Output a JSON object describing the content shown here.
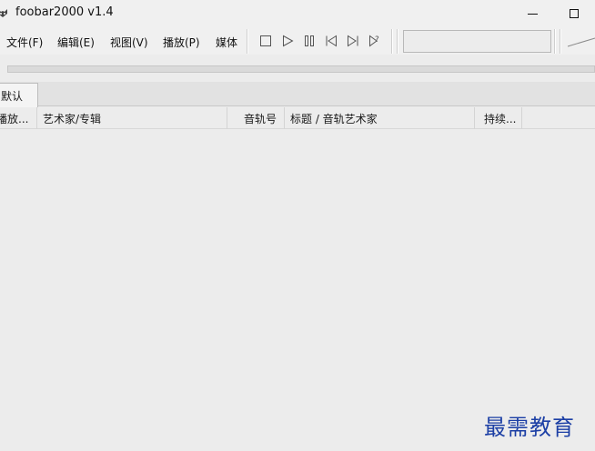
{
  "window": {
    "title": "foobar2000 v1.4",
    "icon": "foobar-raccoon-icon"
  },
  "menu": {
    "items": [
      {
        "label": "文件(F)"
      },
      {
        "label": "编辑(E)"
      },
      {
        "label": "视图(V)"
      },
      {
        "label": "播放(P)"
      },
      {
        "label": "媒体"
      }
    ]
  },
  "transport": {
    "buttons": [
      "stop-icon",
      "play-icon",
      "pause-icon",
      "previous-icon",
      "next-icon",
      "random-icon"
    ]
  },
  "tabs": [
    {
      "label": "默认",
      "active": true
    }
  ],
  "playlist": {
    "columns": [
      {
        "label": "播放..."
      },
      {
        "label": "艺术家/专辑"
      },
      {
        "label": "音轨号"
      },
      {
        "label": "标题 / 音轨艺术家"
      },
      {
        "label": "持续..."
      }
    ],
    "rows": []
  },
  "watermark": {
    "text": "最需教育"
  },
  "colors": {
    "background": "#ececec",
    "watermark": "#1c3fa5"
  }
}
